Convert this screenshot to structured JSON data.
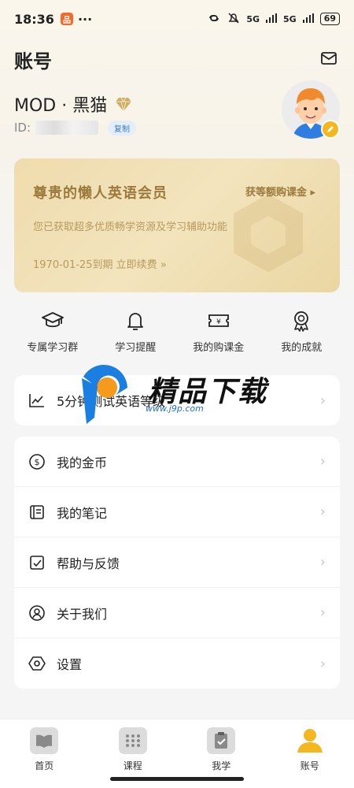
{
  "status_bar": {
    "time": "18:36",
    "app_badge": "品",
    "dots": "···",
    "signal_1": "5G",
    "signal_2": "5G",
    "battery": "69"
  },
  "header": {
    "title": "账号"
  },
  "profile": {
    "name": "MOD · 黑猫",
    "id_label": "ID:",
    "copy_label": "复制"
  },
  "vip": {
    "title": "尊贵的懒人英语会员",
    "link": "获等额购课金 ▸",
    "desc": "您已获取超多优质畅学资源及学习辅助功能",
    "expire": "1970-01-25到期 立即续费 »"
  },
  "quick": [
    {
      "label": "专属学习群",
      "icon": "graduation-cap-icon"
    },
    {
      "label": "学习提醒",
      "icon": "bell-icon"
    },
    {
      "label": "我的购课金",
      "icon": "coupon-icon"
    },
    {
      "label": "我的成就",
      "icon": "medal-icon"
    }
  ],
  "test_row": {
    "label": "5分钟测试英语等级"
  },
  "menu": [
    {
      "label": "我的金币",
      "icon": "coin-icon"
    },
    {
      "label": "我的笔记",
      "icon": "notebook-icon"
    },
    {
      "label": "帮助与反馈",
      "icon": "feedback-icon"
    },
    {
      "label": "关于我们",
      "icon": "user-circle-icon"
    },
    {
      "label": "设置",
      "icon": "settings-icon"
    }
  ],
  "watermark": {
    "text": "精品下载",
    "url": "www.j9p.com"
  },
  "tabs": [
    {
      "label": "首页",
      "icon": "book-icon"
    },
    {
      "label": "课程",
      "icon": "grid-icon"
    },
    {
      "label": "我学",
      "icon": "clipboard-check-icon"
    },
    {
      "label": "账号",
      "icon": "person-icon",
      "active": true
    }
  ],
  "colors": {
    "vip_gold": "#9b7a3c",
    "accent": "#f5b71f"
  }
}
